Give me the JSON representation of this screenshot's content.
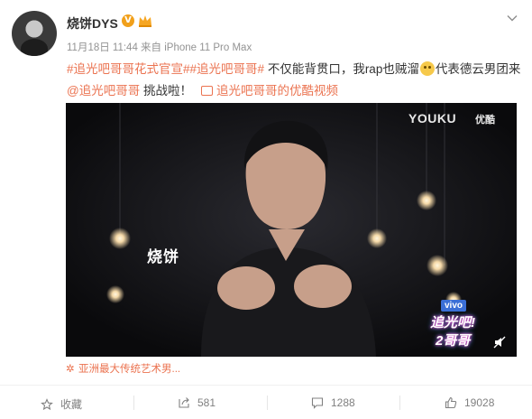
{
  "post": {
    "author": "烧饼DYS",
    "verified_badge": "V",
    "meta": "11月18日 11:44 来自 iPhone 11 Pro Max",
    "text": {
      "tag1": "#追光吧哥哥花式官宣#",
      "tag2": "#追光吧哥哥#",
      "body1": " 不仅能背贯口，我rap也贼溜",
      "body2": "代表德云男团来",
      "mention": "@追光吧哥哥",
      "body3": " 挑战啦！",
      "video_link": "追光吧哥哥的优酷视频"
    },
    "video": {
      "watermark": "YOUKU",
      "watermark_cn": "优酷",
      "caption": "烧饼",
      "sponsor": "vivo",
      "show_logo_line1": "追光吧!",
      "show_logo_line2": "2哥哥"
    },
    "source": "亚洲最大传统艺术男..."
  },
  "actions": [
    {
      "label": "收藏",
      "icon": "star-icon"
    },
    {
      "label": "581",
      "icon": "share-icon"
    },
    {
      "label": "1288",
      "icon": "comment-icon"
    },
    {
      "label": "19028",
      "icon": "like-icon"
    }
  ],
  "colors": {
    "link": "#eb7350",
    "text": "#333333",
    "meta": "#939393",
    "badge": "#f1a01b"
  }
}
